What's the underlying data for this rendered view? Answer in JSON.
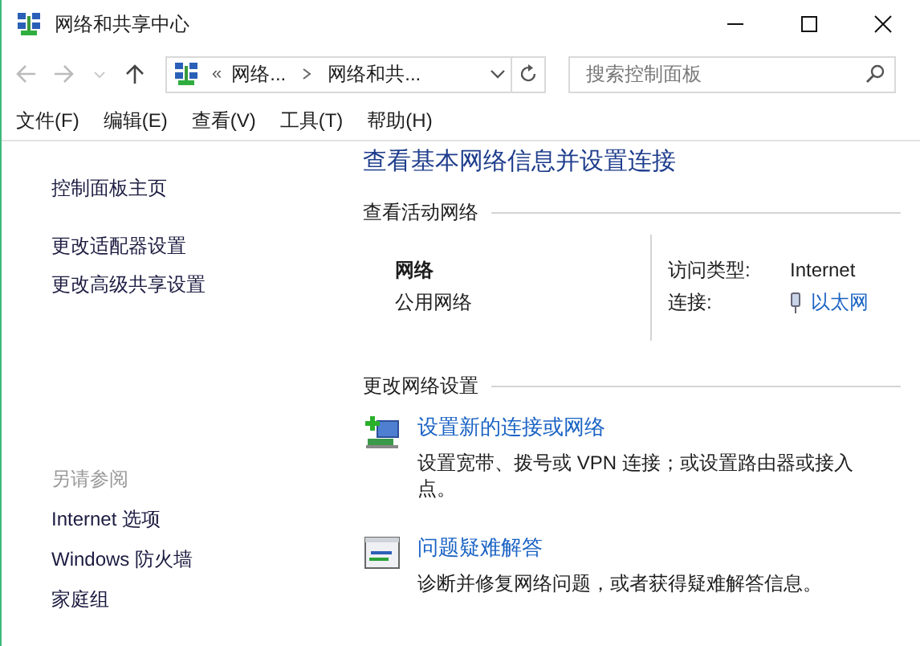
{
  "window": {
    "title": "网络和共享中心"
  },
  "address_bar": {
    "overflow": "«",
    "crumbs": [
      "网络...",
      "网络和共..."
    ]
  },
  "search": {
    "placeholder": "搜索控制面板"
  },
  "menu": [
    "文件(F)",
    "编辑(E)",
    "查看(V)",
    "工具(T)",
    "帮助(H)"
  ],
  "sidebar": {
    "links": [
      "控制面板主页",
      "更改适配器设置",
      "更改高级共享设置"
    ],
    "see_also": {
      "heading": "另请参阅",
      "links": [
        "Internet 选项",
        "Windows 防火墙",
        "家庭组"
      ]
    }
  },
  "main": {
    "heading": "查看基本网络信息并设置连接",
    "active_networks": {
      "heading": "查看活动网络",
      "network_name": "网络",
      "network_type": "公用网络",
      "access_type_label": "访问类型:",
      "access_type": "Internet",
      "connection_label": "连接:",
      "connection": "以太网"
    },
    "change_settings": {
      "heading": "更改网络设置",
      "tasks": [
        {
          "kind": "new-connection",
          "title": "设置新的连接或网络",
          "description": "设置宽带、拨号或 VPN 连接；或设置路由器或接入点。"
        },
        {
          "kind": "troubleshoot",
          "title": "问题疑难解答",
          "description": "诊断并修复网络问题，或者获得疑难解答信息。"
        }
      ]
    }
  }
}
